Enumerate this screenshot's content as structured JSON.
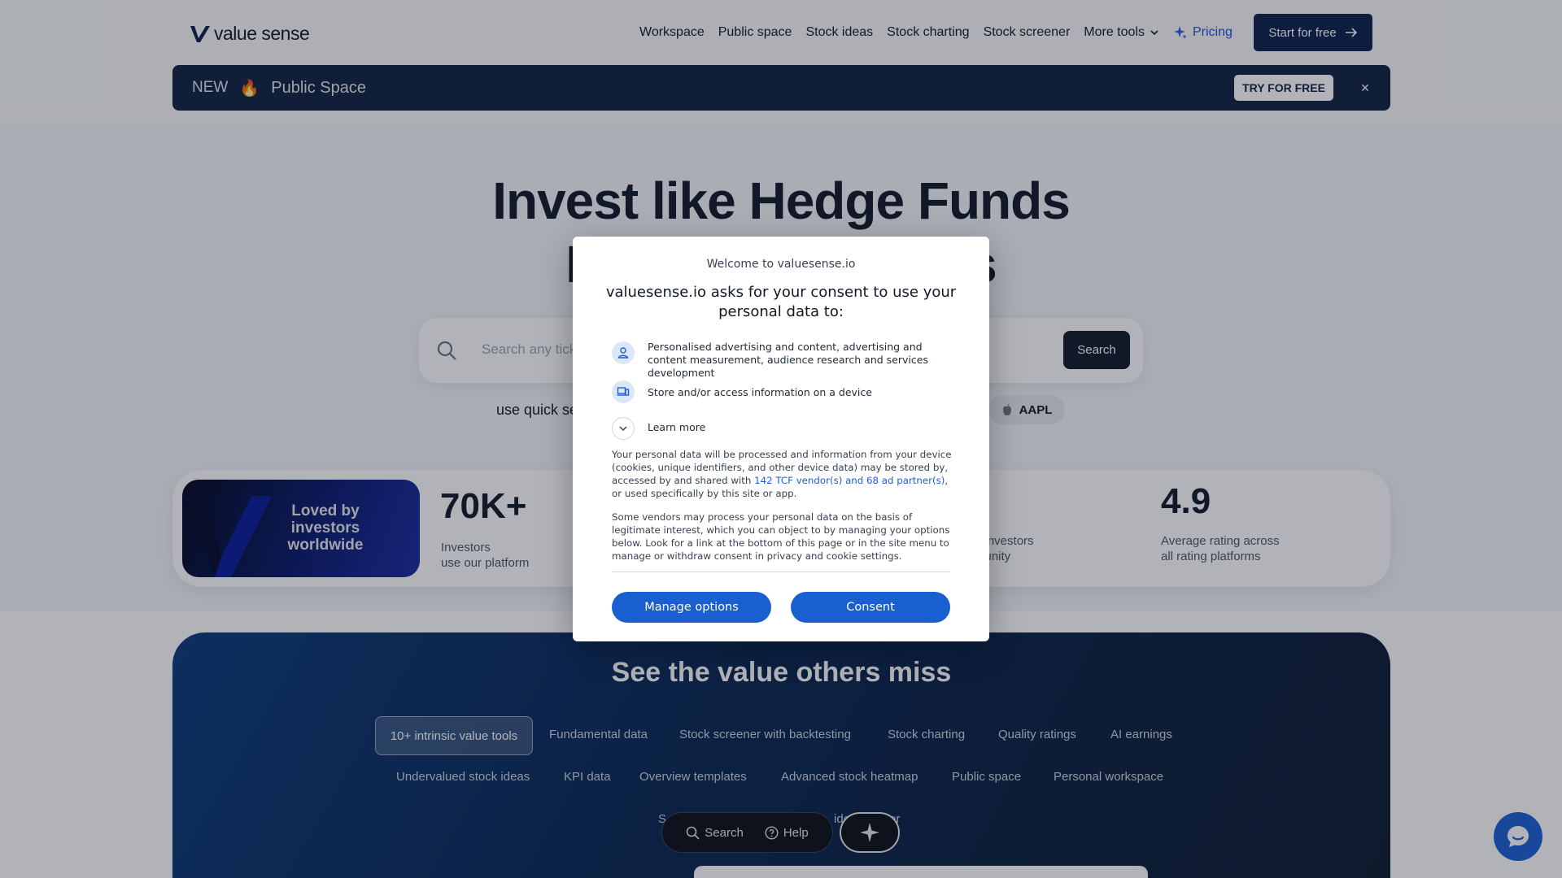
{
  "brand": {
    "logo_text": "value sense",
    "accent": "#0b1f4b"
  },
  "nav": {
    "items": [
      "Workspace",
      "Public space",
      "Stock ideas",
      "Stock charting",
      "Stock screener"
    ],
    "more_tools": "More tools",
    "pricing": "Pricing",
    "start_button": "Start for free"
  },
  "banner": {
    "new_label": "NEW",
    "emoji": "🔥",
    "title": "Public Space",
    "try_button": "TRY FOR FREE",
    "close_label": "×"
  },
  "hero": {
    "line1": "Invest like Hedge Funds",
    "line2_left": "In",
    "line2_right": "s",
    "search_placeholder": "Search any tick",
    "search_button": "Search",
    "quick_search": "use quick se",
    "quick_ticker": "AAPL"
  },
  "stats": {
    "loved_text": "Loved by investors worldwide",
    "items": [
      {
        "value": "70K+",
        "label_line1": "Investors",
        "label_line2": "use our platform"
      },
      {
        "value": "",
        "label_line1": "d investors",
        "label_line2": "munity"
      },
      {
        "value": "4.9",
        "label_line1": "Average rating across",
        "label_line2": "all rating platforms"
      }
    ]
  },
  "features": {
    "title": "See the value others miss",
    "active_tab": "10+ intrinsic value tools",
    "tabs_row1": [
      "Fundamental data",
      "Stock screener with backtesting",
      "Stock charting",
      "Quality ratings",
      "AI earnings"
    ],
    "tabs_row2": [
      "Undervalued stock ideas",
      "KPI data",
      "Overview templates",
      "Advanced stock heatmap",
      "Public space",
      "Personal workspace"
    ],
    "tabs_row3_left": "S",
    "tabs_row3_mid": "ide",
    "tabs_row3_right": "er"
  },
  "dock": {
    "search": "Search",
    "help": "Help"
  },
  "consent": {
    "welcome": "Welcome to valuesense.io",
    "heading": "valuesense.io asks for your consent to use your personal data to:",
    "purposes": [
      "Personalised advertising and content, advertising and content measurement, audience research and services development",
      "Store and/or access information on a device"
    ],
    "learn_more": "Learn more",
    "para1_a": "Your personal data will be processed and information from your device (cookies, unique identifiers, and other device data) may be stored by, accessed by and shared with ",
    "para1_link": "142 TCF vendor(s) and 68 ad partner(s)",
    "para1_b": ", or used specifically by this site or app.",
    "para2": "Some vendors may process your personal data on the basis of legitimate interest, which you can object to by managing your options below. Look for a link at the bottom of this page or in the site menu to manage or withdraw consent in privacy and cookie settings.",
    "manage_button": "Manage options",
    "consent_button": "Consent"
  }
}
